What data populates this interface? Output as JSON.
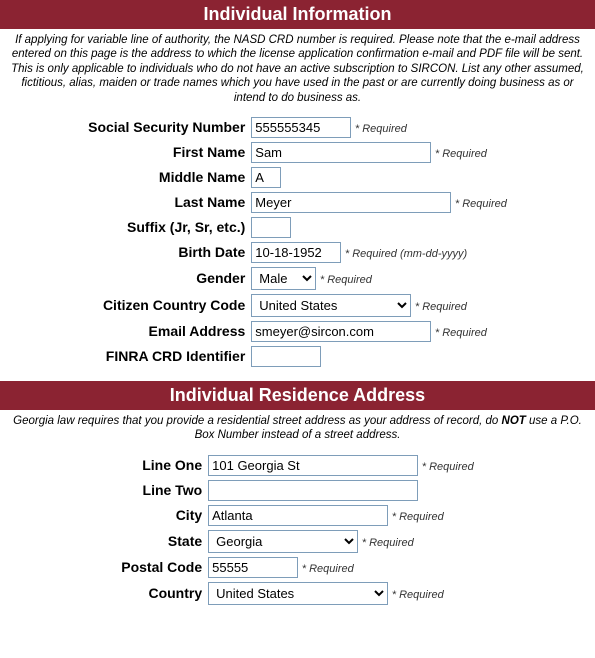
{
  "section1": {
    "title": "Individual Information",
    "note": "If applying for variable line of authority, the NASD CRD number is required. Please note that the e-mail address entered on this page is the address to which the license application confirmation e-mail and PDF file will be sent. This is only applicable to individuals who do not have an active subscription to SIRCON. List any other assumed, fictitious, alias, maiden or trade names which you have used in the past or are currently doing business as or intend to do business as.",
    "fields": {
      "ssn": {
        "label": "Social Security Number",
        "value": "555555345",
        "req": "* Required"
      },
      "firstName": {
        "label": "First Name",
        "value": "Sam",
        "req": "* Required"
      },
      "middleName": {
        "label": "Middle Name",
        "value": "A"
      },
      "lastName": {
        "label": "Last Name",
        "value": "Meyer",
        "req": "* Required"
      },
      "suffix": {
        "label": "Suffix (Jr, Sr, etc.)",
        "value": ""
      },
      "birthDate": {
        "label": "Birth Date",
        "value": "10-18-1952",
        "req": "* Required (mm-dd-yyyy)"
      },
      "gender": {
        "label": "Gender",
        "value": "Male",
        "req": "* Required"
      },
      "citizenCountry": {
        "label": "Citizen Country Code",
        "value": "United States",
        "req": "* Required"
      },
      "email": {
        "label": "Email Address",
        "value": "smeyer@sircon.com",
        "req": "* Required"
      },
      "finra": {
        "label": "FINRA CRD Identifier",
        "value": ""
      }
    }
  },
  "section2": {
    "title": "Individual Residence Address",
    "notePrefix": "Georgia law requires that you provide a residential street address as your address of record, do ",
    "noteBold": "NOT",
    "noteSuffix": " use a P.O. Box Number instead of a street address.",
    "fields": {
      "line1": {
        "label": "Line One",
        "value": "101 Georgia St",
        "req": "* Required"
      },
      "line2": {
        "label": "Line Two",
        "value": ""
      },
      "city": {
        "label": "City",
        "value": "Atlanta",
        "req": "* Required"
      },
      "state": {
        "label": "State",
        "value": "Georgia",
        "req": "* Required"
      },
      "postal": {
        "label": "Postal Code",
        "value": "55555",
        "req": "* Required"
      },
      "country": {
        "label": "Country",
        "value": "United States",
        "req": "* Required"
      }
    }
  }
}
